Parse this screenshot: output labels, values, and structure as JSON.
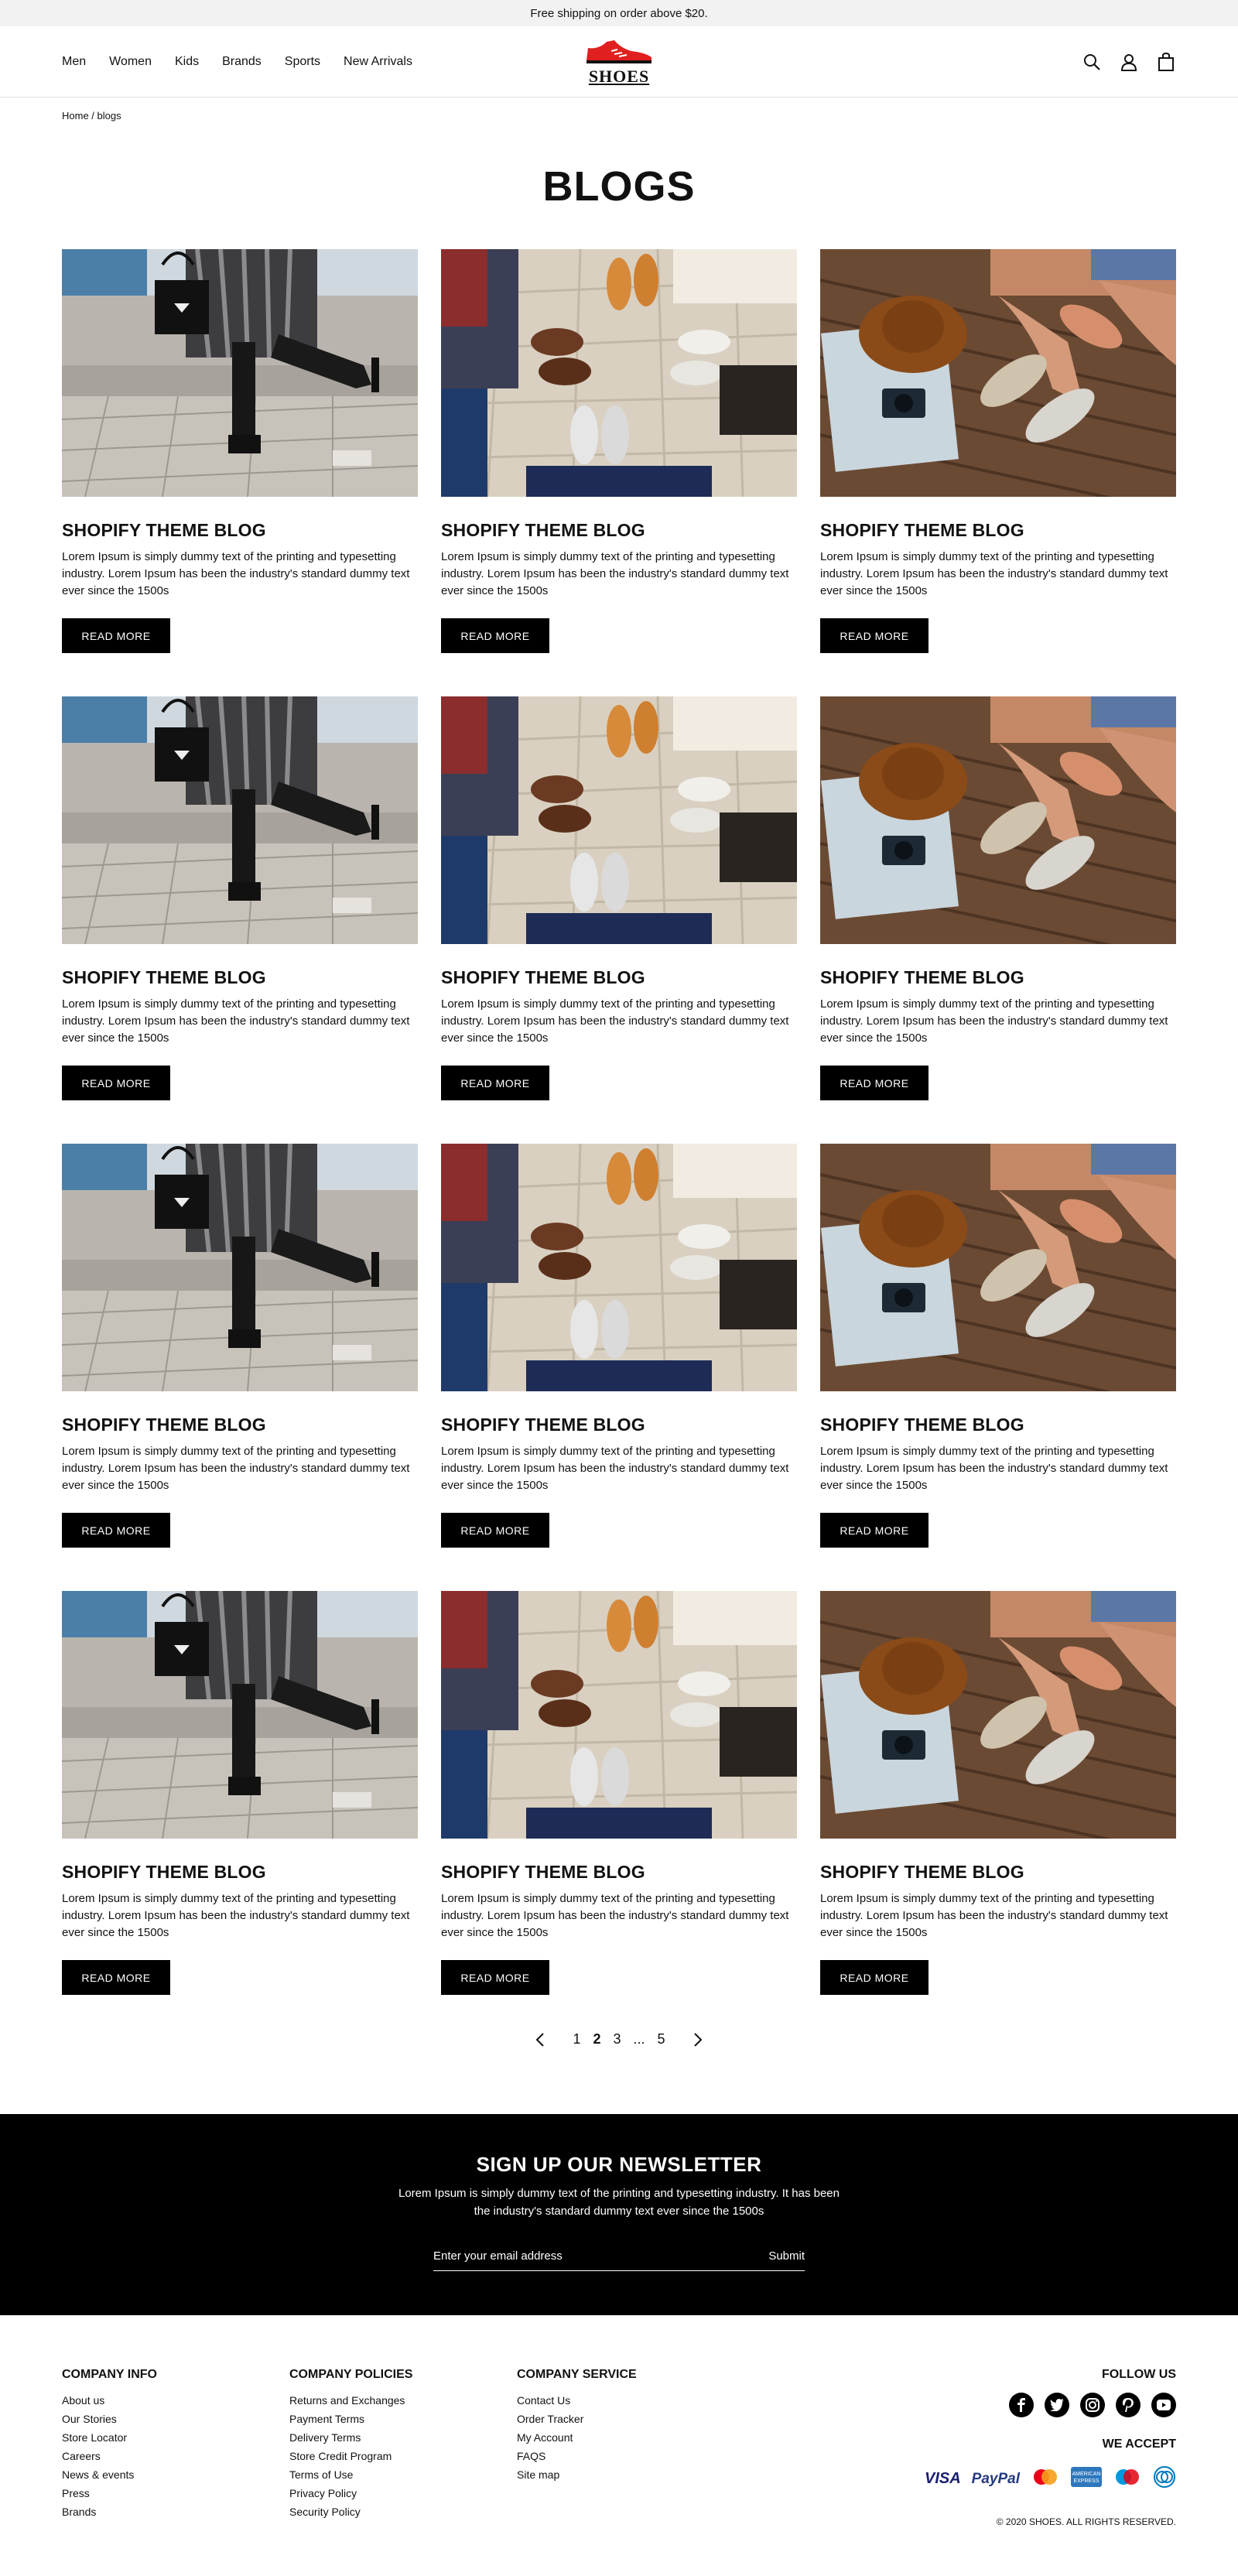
{
  "announcement": "Free shipping on order above $20.",
  "nav": {
    "links": [
      "Men",
      "Women",
      "Kids",
      "Brands",
      "Sports",
      "New Arrivals"
    ],
    "logo_text": "SHOES"
  },
  "breadcrumb": "Home / blogs",
  "page_title": "BLOGS",
  "posts": [
    {
      "title": "SHOPIFY THEME BLOG",
      "excerpt": "Lorem Ipsum is simply dummy text of the printing and typesetting industry. Lorem Ipsum has been the industry's standard dummy text ever since the 1500s",
      "button": "READ MORE",
      "image": "woman-handbag-boots"
    },
    {
      "title": "SHOPIFY THEME BLOG",
      "excerpt": "Lorem Ipsum is simply dummy text of the printing and typesetting industry. Lorem Ipsum has been the industry's standard dummy text ever since the 1500s",
      "button": "READ MORE",
      "image": "feet-circle-shoes"
    },
    {
      "title": "SHOPIFY THEME BLOG",
      "excerpt": "Lorem Ipsum is simply dummy text of the printing and typesetting industry. Lorem Ipsum has been the industry's standard dummy text ever since the 1500s",
      "button": "READ MORE",
      "image": "hat-camera-sneakers"
    },
    {
      "title": "SHOPIFY THEME BLOG",
      "excerpt": "Lorem Ipsum is simply dummy text of the printing and typesetting industry. Lorem Ipsum has been the industry's standard dummy text ever since the 1500s",
      "button": "READ MORE",
      "image": "woman-handbag-boots"
    },
    {
      "title": "SHOPIFY THEME BLOG",
      "excerpt": "Lorem Ipsum is simply dummy text of the printing and typesetting industry. Lorem Ipsum has been the industry's standard dummy text ever since the 1500s",
      "button": "READ MORE",
      "image": "feet-circle-shoes"
    },
    {
      "title": "SHOPIFY THEME BLOG",
      "excerpt": "Lorem Ipsum is simply dummy text of the printing and typesetting industry. Lorem Ipsum has been the industry's standard dummy text ever since the 1500s",
      "button": "READ MORE",
      "image": "hat-camera-sneakers"
    },
    {
      "title": "SHOPIFY THEME BLOG",
      "excerpt": "Lorem Ipsum is simply dummy text of the printing and typesetting industry. Lorem Ipsum has been the industry's standard dummy text ever since the 1500s",
      "button": "READ MORE",
      "image": "woman-handbag-boots"
    },
    {
      "title": "SHOPIFY THEME BLOG",
      "excerpt": "Lorem Ipsum is simply dummy text of the printing and typesetting industry. Lorem Ipsum has been the industry's standard dummy text ever since the 1500s",
      "button": "READ MORE",
      "image": "feet-circle-shoes"
    },
    {
      "title": "SHOPIFY THEME BLOG",
      "excerpt": "Lorem Ipsum is simply dummy text of the printing and typesetting industry. Lorem Ipsum has been the industry's standard dummy text ever since the 1500s",
      "button": "READ MORE",
      "image": "hat-camera-sneakers"
    },
    {
      "title": "SHOPIFY THEME BLOG",
      "excerpt": "Lorem Ipsum is simply dummy text of the printing and typesetting industry. Lorem Ipsum has been the industry's standard dummy text ever since the 1500s",
      "button": "READ MORE",
      "image": "woman-handbag-boots"
    },
    {
      "title": "SHOPIFY THEME BLOG",
      "excerpt": "Lorem Ipsum is simply dummy text of the printing and typesetting industry. Lorem Ipsum has been the industry's standard dummy text ever since the 1500s",
      "button": "READ MORE",
      "image": "feet-circle-shoes"
    },
    {
      "title": "SHOPIFY THEME BLOG",
      "excerpt": "Lorem Ipsum is simply dummy text of the printing and typesetting industry. Lorem Ipsum has been the industry's standard dummy text ever since the 1500s",
      "button": "READ MORE",
      "image": "hat-camera-sneakers"
    }
  ],
  "pagination": {
    "pages": [
      "1",
      "2",
      "3",
      "...",
      "5"
    ],
    "active": "2"
  },
  "newsletter": {
    "title": "SIGN UP OUR NEWSLETTER",
    "text": "Lorem Ipsum is simply dummy text of the printing and typesetting industry. It has been the industry's standard dummy text ever since the 1500s",
    "placeholder": "Enter your email address",
    "submit": "Submit"
  },
  "footer": {
    "company_info": {
      "title": "COMPANY INFO",
      "links": [
        "About us",
        "Our Stories",
        "Store Locator",
        "Careers",
        "News & events",
        "Press",
        "Brands"
      ]
    },
    "company_policies": {
      "title": "COMPANY POLICIES",
      "links": [
        "Returns and Exchanges",
        "Payment Terms",
        "Delivery Terms",
        "Store Credit Program",
        "Terms of Use",
        "Privacy Policy",
        "Security Policy"
      ]
    },
    "company_service": {
      "title": "COMPANY SERVICE",
      "links": [
        "Contact Us",
        "Order Tracker",
        "My Account",
        "FAQS",
        "Site map"
      ]
    },
    "follow_title": "FOLLOW US",
    "socials": [
      "facebook-icon",
      "twitter-icon",
      "instagram-icon",
      "pinterest-icon",
      "youtube-icon"
    ],
    "accept_title": "WE ACCEPT",
    "payments": [
      "VISA",
      "PayPal",
      "mastercard",
      "AMERICAN EXPRESS",
      "maestro",
      "diners-club"
    ],
    "copyright": "© 2020 SHOES. ALL RIGHTS RESERVED."
  },
  "colors": {
    "brand_red": "#e02020",
    "black": "#000000"
  }
}
